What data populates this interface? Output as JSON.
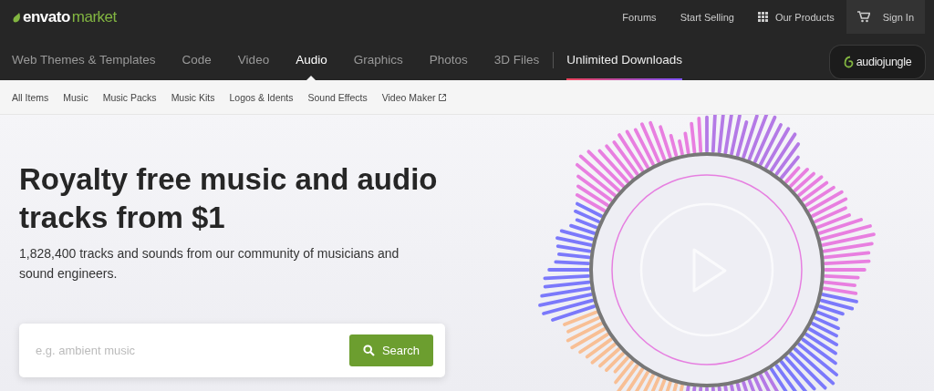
{
  "logo": {
    "primary": "envato",
    "secondary": "market"
  },
  "top_links": [
    {
      "label": "Forums",
      "kind": "text"
    },
    {
      "label": "Start Selling",
      "kind": "text"
    },
    {
      "label": "Our Products",
      "kind": "grid"
    }
  ],
  "sign_in": {
    "label": "Sign In"
  },
  "categories": [
    {
      "label": "Web Themes & Templates",
      "selected": false,
      "kind": "normal"
    },
    {
      "label": "Code",
      "selected": false,
      "kind": "normal"
    },
    {
      "label": "Video",
      "selected": false,
      "kind": "normal"
    },
    {
      "label": "Audio",
      "selected": true,
      "kind": "normal"
    },
    {
      "label": "Graphics",
      "selected": false,
      "kind": "normal"
    },
    {
      "label": "Photos",
      "selected": false,
      "kind": "normal"
    },
    {
      "label": "3D Files",
      "selected": false,
      "kind": "normal"
    },
    {
      "label": "Unlimited Downloads",
      "selected": false,
      "kind": "featured"
    }
  ],
  "site_badge": {
    "text": "audiojungle"
  },
  "subnav": [
    {
      "label": "All Items",
      "external": false
    },
    {
      "label": "Music",
      "external": false
    },
    {
      "label": "Music Packs",
      "external": false
    },
    {
      "label": "Music Kits",
      "external": false
    },
    {
      "label": "Logos & Idents",
      "external": false
    },
    {
      "label": "Sound Effects",
      "external": false
    },
    {
      "label": "Video Maker",
      "external": true
    }
  ],
  "hero": {
    "title": "Royalty free music and audio tracks from $1",
    "subtitle": "1,828,400 tracks and sounds from our community of musicians and sound engineers."
  },
  "search": {
    "placeholder": "e.g. ambient music",
    "button": "Search"
  }
}
